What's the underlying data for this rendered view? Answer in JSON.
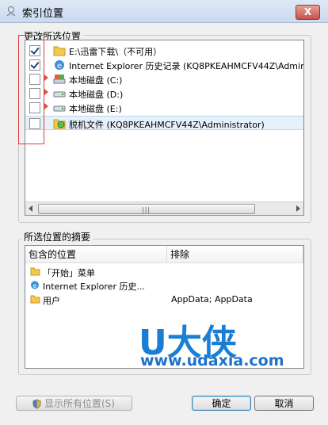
{
  "window": {
    "title": "索引位置",
    "close_label": "X"
  },
  "change_section": {
    "label": "更改所选位置",
    "rows": [
      {
        "checked": true,
        "expander": false,
        "icon": "folder-icon",
        "label": "E:\\迅雷下载\\（不可用）"
      },
      {
        "checked": true,
        "expander": false,
        "icon": "ie-icon",
        "label": "Internet Explorer 历史记录 (KQ8PKEAHMCFV44Z\\Admin"
      },
      {
        "checked": false,
        "expander": true,
        "icon": "disk-icon",
        "label": "本地磁盘 (C:)"
      },
      {
        "checked": false,
        "expander": true,
        "icon": "disk-icon",
        "label": "本地磁盘 (D:)"
      },
      {
        "checked": false,
        "expander": true,
        "icon": "disk-icon",
        "label": "本地磁盘 (E:)"
      },
      {
        "checked": false,
        "expander": false,
        "icon": "offline-files-icon",
        "label": "脱机文件 (KQ8PKEAHMCFV44Z\\Administrator)"
      }
    ]
  },
  "summary_section": {
    "label": "所选位置的摘要",
    "columns": [
      "包含的位置",
      "排除"
    ],
    "rows": [
      {
        "icon": "folder-icon",
        "location": "「开始」菜单",
        "exclude": ""
      },
      {
        "icon": "ie-icon",
        "location": "Internet Explorer 历史...",
        "exclude": ""
      },
      {
        "icon": "folder-icon",
        "location": "用户",
        "exclude": "AppData; AppData"
      }
    ]
  },
  "watermark": {
    "brand": "U大侠",
    "url": "www.udaxia.com"
  },
  "buttons": {
    "show_all": "显示所有位置(S)",
    "ok": "确定",
    "cancel": "取消"
  }
}
